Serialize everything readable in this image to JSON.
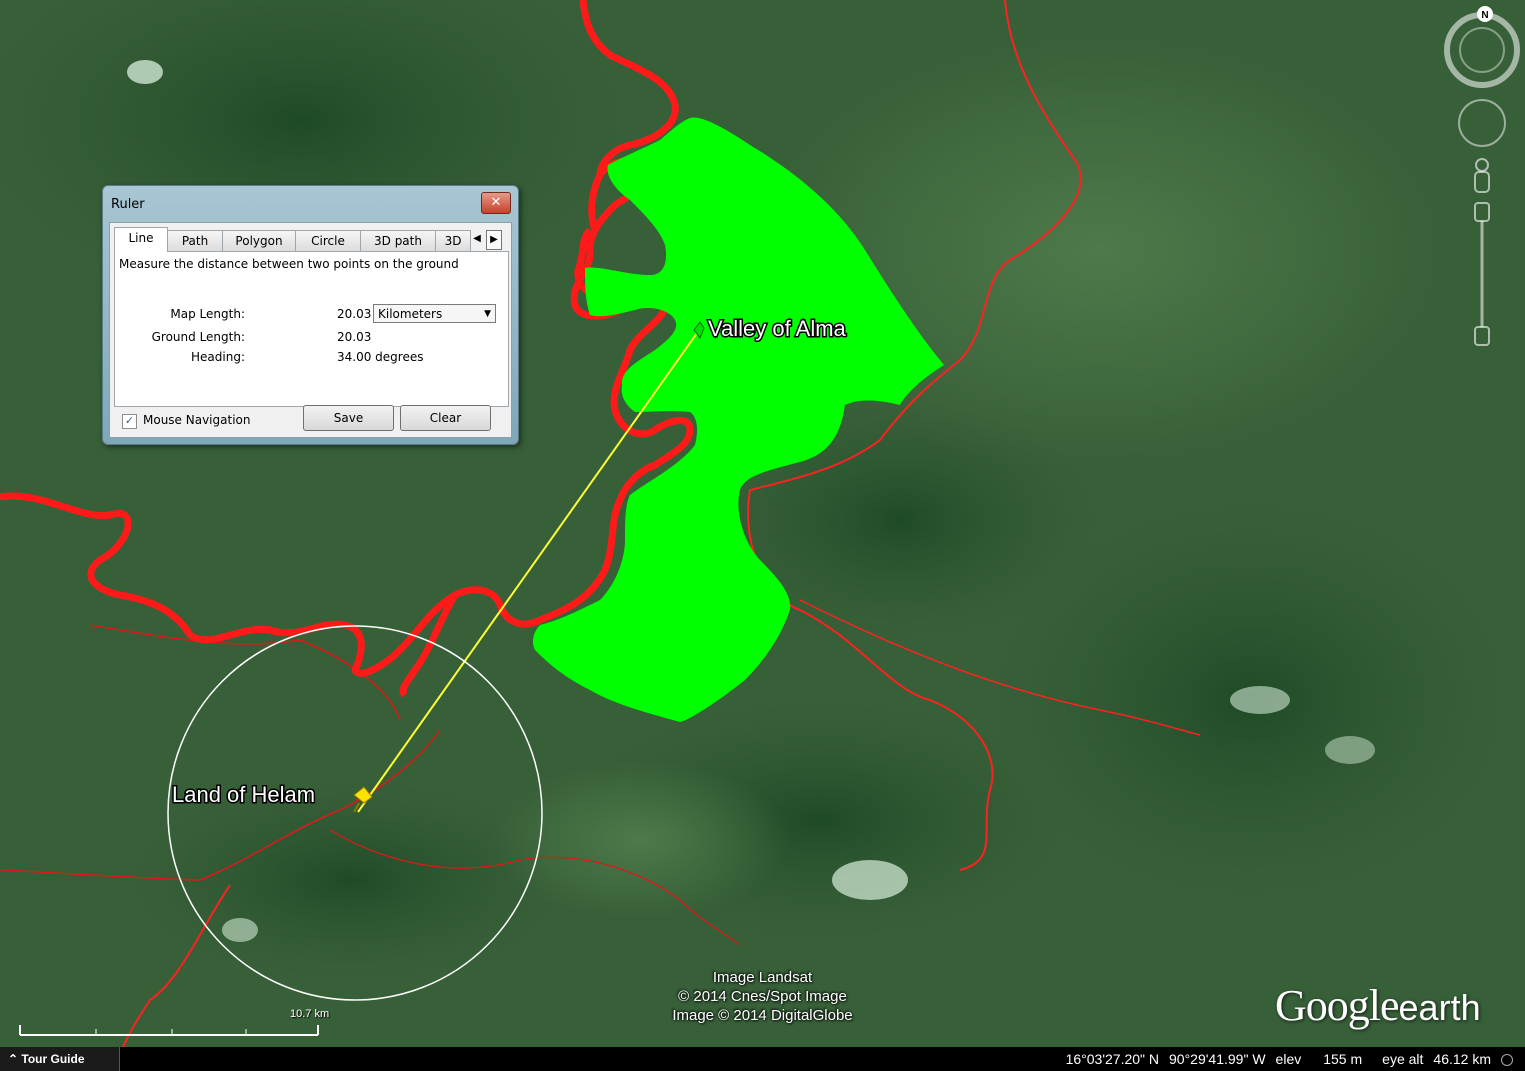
{
  "map": {
    "placemarks": [
      {
        "name": "Valley of Alma"
      },
      {
        "name": "Land of Helam"
      }
    ],
    "attribution": [
      "Image Landsat",
      "© 2014 Cnes/Spot Image",
      "Image © 2014 DigitalGlobe"
    ],
    "scale_label": "10.7 km",
    "logo_google": "Google",
    "logo_earth": "earth",
    "compass_north": "N"
  },
  "ruler": {
    "title": "Ruler",
    "close_label": "✕",
    "tabs": [
      "Line",
      "Path",
      "Polygon",
      "Circle",
      "3D path",
      "3D"
    ],
    "active_tab": "Line",
    "description": "Measure the distance between two points on the ground",
    "map_length_label": "Map Length:",
    "map_length_value": "20.03",
    "units": "Kilometers",
    "ground_length_label": "Ground Length:",
    "ground_length_value": "20.03",
    "heading_label": "Heading:",
    "heading_value": "34.00 degrees",
    "mouse_navigation_label": "Mouse Navigation",
    "mouse_navigation_checked": true,
    "save_label": "Save",
    "clear_label": "Clear"
  },
  "status": {
    "tour_guide": "Tour Guide",
    "lat": "16°03'27.20\" N",
    "lon": "90°29'41.99\" W",
    "elev_label": "elev",
    "elev_value": "155 m",
    "eye_alt_label": "eye alt",
    "eye_alt_value": "46.12 km"
  },
  "colors": {
    "polygon": "#00ff00",
    "river": "#ff1a1a",
    "measure_line": "#ffff33",
    "circle": "#ffffff"
  }
}
